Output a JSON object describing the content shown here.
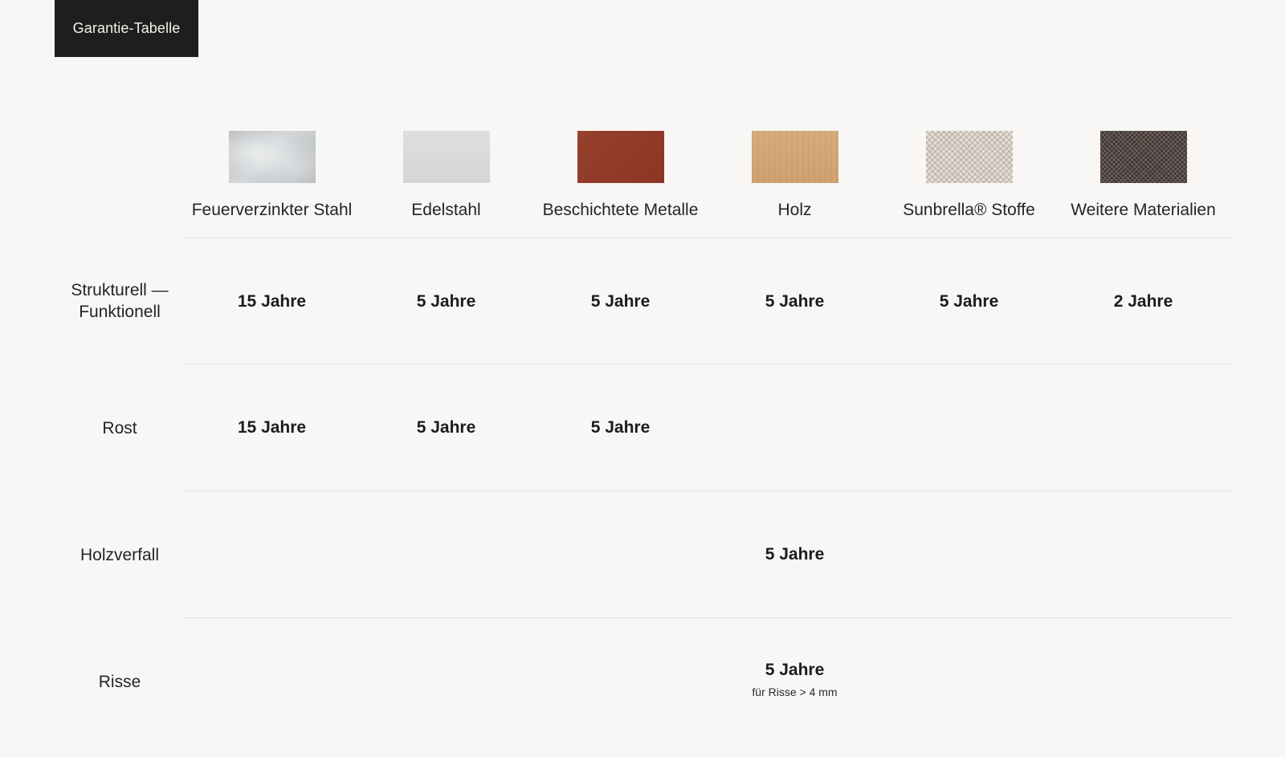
{
  "tab": {
    "label": "Garantie-Tabelle"
  },
  "materials": [
    {
      "label": "Feuerverzinkter Stahl",
      "swatch": "galvanized-steel-swatch"
    },
    {
      "label": "Edelstahl",
      "swatch": "stainless-steel-swatch"
    },
    {
      "label": "Beschichtete Metalle",
      "swatch": "coated-metal-swatch",
      "color": "#8f3b27"
    },
    {
      "label": "Holz",
      "swatch": "wood-swatch",
      "color": "#d4a877"
    },
    {
      "label": "Sunbrella® Stoffe",
      "swatch": "fabric-swatch",
      "color": "#e2ddd5"
    },
    {
      "label": "Weitere Materialien",
      "swatch": "other-material-swatch",
      "color": "#3f3836"
    }
  ],
  "rows": [
    {
      "label": "Strukturell — Funktionell",
      "values": [
        "15 Jahre",
        "5 Jahre",
        "5 Jahre",
        "5 Jahre",
        "5 Jahre",
        "2 Jahre"
      ]
    },
    {
      "label": "Rost",
      "values": [
        "15 Jahre",
        "5 Jahre",
        "5 Jahre",
        "",
        "",
        ""
      ]
    },
    {
      "label": "Holzverfall",
      "values": [
        "",
        "",
        "",
        "5 Jahre",
        "",
        ""
      ]
    },
    {
      "label": "Risse",
      "values": [
        "",
        "",
        "",
        "5 Jahre",
        "",
        ""
      ],
      "note": "für Risse > 4 mm"
    }
  ]
}
